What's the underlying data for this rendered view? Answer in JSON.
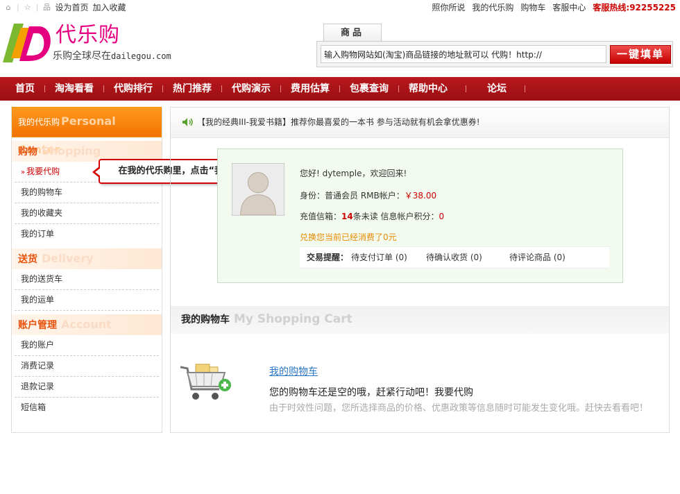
{
  "topbar": {
    "set_home": "设为首页",
    "bookmark": "加入收藏",
    "links": [
      "照你所说",
      "我的代乐购",
      "购物车",
      "客服中心"
    ],
    "hotline": "客服热线:92255225"
  },
  "header": {
    "brand": "代乐购",
    "slogan": "乐购全球尽在",
    "domain": "dailegou.com",
    "tab": "商品",
    "search_value": "输入购物网站如(淘宝)商品链接的地址就可以 代购！http://",
    "search_button": "一键填单"
  },
  "nav": {
    "items": [
      "首页",
      "淘淘看看",
      "代购排行",
      "热门推荐",
      "代购演示",
      "费用估算",
      "包裹查询",
      "帮助中心",
      "论坛"
    ]
  },
  "sidebar": {
    "header_cn": "我的代乐购",
    "header_en": "Personal Center",
    "sections": [
      {
        "cn": "购物",
        "en": "Shopping",
        "items": [
          "我要代购",
          "我的购物车",
          "我的收藏夹",
          "我的订单"
        ]
      },
      {
        "cn": "送货",
        "en": "Delivery",
        "items": [
          "我的送货车",
          "我的运单"
        ]
      },
      {
        "cn": "账户管理",
        "en": "Account",
        "items": [
          "我的账户",
          "消费记录",
          "退款记录",
          "短信箱"
        ]
      }
    ]
  },
  "callout": {
    "text": "在我的代乐购里，点击“我要代购”"
  },
  "notice": {
    "text": "【我的经典III-我爱书籍】推荐你最喜爱的一本书 参与活动就有机会拿优惠券!"
  },
  "user": {
    "greeting": "您好! dytemple，欢迎回来!",
    "identity_prefix": "身份：普通会员 RMB帐户：",
    "balance": "￥38.00",
    "inbox_prefix": "充值信箱：",
    "unread": "14",
    "inbox_suffix": "条未读 信息帐户积分：",
    "points": "0",
    "exchange": "兑换您当前已经消费了0元",
    "trade_label": "交易提醒：",
    "pending_pay": "待支付订单 (0)",
    "pending_receive": "待确认收货 (0)",
    "pending_review": "待评论商品 (0)"
  },
  "cart": {
    "title_cn": "我的购物车",
    "title_en": "My Shopping Cart",
    "link": "我的购物车",
    "empty": "您的购物车还是空的哦，赶紧行动吧！我要代购",
    "note": "由于时效性问题，您所选择商品的价格、优惠政策等信息随时可能发生变化哦。赶快去看看吧！"
  },
  "colors": {
    "nav_red": "#b8191d",
    "brand_pink": "#e4007f",
    "sidebar_orange": "#f27200",
    "callout_red": "#d40000",
    "link_blue": "#2a77c7"
  }
}
